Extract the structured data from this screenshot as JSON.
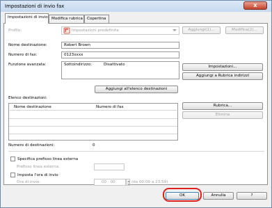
{
  "window": {
    "title": "Impostazioni di invio fax",
    "close_glyph": "x"
  },
  "tabs": [
    {
      "label": "Impostazioni di invio"
    },
    {
      "label": "Modifica rubrica"
    },
    {
      "label": "Copertina"
    }
  ],
  "profile": {
    "label": "Profilo:",
    "value": "Impostazioni predefinite",
    "add_button": "Aggiungi(1)...",
    "edit_button": "Modifica(2)..."
  },
  "form": {
    "name_label": "Nome destinazione:",
    "name_value": "Robert Brown",
    "fax_label": "Numero di fax:",
    "fax_value": "0123xxxx",
    "functions_label": "Funzione avanzata:",
    "subaddress_label": "Sottoindirizzo:",
    "subaddress_value": "Disattivato",
    "settings_button": "Impostazioni...",
    "add_address_book_button": "Aggiungi a Rubrica indirizzi"
  },
  "add_to_list_button": "Aggiungi all'elenco destinazioni",
  "destinations": {
    "label": "Elenco destinazioni:",
    "columns": [
      "Nome destinazione",
      "Numero di fax"
    ],
    "address_book_button": "Rubrica...",
    "delete_button": "Elimina",
    "count_label": "Numero di destinazioni:",
    "count_value": "0"
  },
  "external_prefix": {
    "checkbox_label": "Specifica prefisso linea esterna",
    "prefix_label": "Prefisso linea esterna:",
    "prefix_value": ""
  },
  "send_time": {
    "checkbox_label": "Imposta l'ora di invio",
    "time_label": "Ora di invio:",
    "hour": "00",
    "separator": ":",
    "minute": "00",
    "range_hint": "(da 00:00 a 23:59)"
  },
  "footer": {
    "ok_button": "OK",
    "cancel_button": "Annulla",
    "help_button": "?"
  },
  "colors": {
    "highlight_ring": "#e0201c",
    "title_bar": "#c6d9ef",
    "close_button": "#c4422c",
    "disabled_text": "#a0a0a0"
  },
  "icons": {
    "profile": "fax-profile-icon",
    "dropdown": "chevron-down-icon",
    "close": "close-icon",
    "spinner": "spinner-arrows-icon"
  }
}
